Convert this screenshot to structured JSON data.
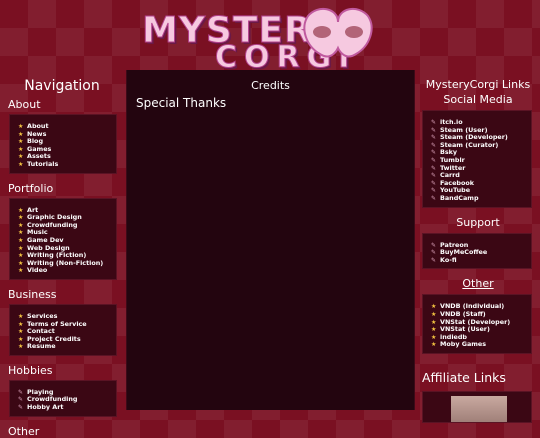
{
  "logo": {
    "word1": "MYSTERY",
    "word2": "CORGI"
  },
  "left": {
    "title": "Navigation",
    "sections": [
      {
        "title": "About",
        "icon": "star-icon",
        "items": [
          "About",
          "News",
          "Blog",
          "Games",
          "Assets",
          "Tutorials"
        ]
      },
      {
        "title": "Portfolio",
        "icon": "star-icon",
        "items": [
          "Art",
          "Graphic Design",
          "Crowdfunding",
          "Music",
          "Game Dev",
          "Web Design",
          "Writing (Fiction)",
          "Writing (Non-Fiction)",
          "Video"
        ]
      },
      {
        "title": "Business",
        "icon": "star-icon",
        "items": [
          "Services",
          "Terms of Service",
          "Contact",
          "Project Credits",
          "Resume"
        ]
      },
      {
        "title": "Hobbies",
        "icon": "pen-icon",
        "items": [
          "Playing",
          "Crowdfunding",
          "Hobby Art"
        ]
      }
    ],
    "truncated_title": "Other"
  },
  "center": {
    "title": "Credits",
    "heading": "Special Thanks"
  },
  "right": {
    "title": "MysteryCorgi Links",
    "sections": [
      {
        "title": "Social Media",
        "icon": "pen-icon",
        "items": [
          "itch.io",
          "Steam (User)",
          "Steam (Developer)",
          "Steam (Curator)",
          "Bsky",
          "Tumblr",
          "Twitter",
          "Carrd",
          "Facebook",
          "YouTube",
          "BandCamp"
        ]
      },
      {
        "title": "Support",
        "icon": "pen-icon",
        "items": [
          "Patreon",
          "BuyMeCoffee",
          "Ko-fi"
        ]
      },
      {
        "title": "Other",
        "icon": "star-icon",
        "items": [
          "VNDB (Individual)",
          "VNDB (Staff)",
          "VNStat (Developer)",
          "VNStat (User)",
          "indiedb",
          "Moby Games"
        ]
      }
    ],
    "affiliate_title": "Affiliate Links"
  },
  "colors": {
    "background": "#7a1022",
    "panel": "#3b0714",
    "center_panel": "#23050f",
    "star": "#f4c542",
    "logo_pink": "#f6c9e0"
  }
}
